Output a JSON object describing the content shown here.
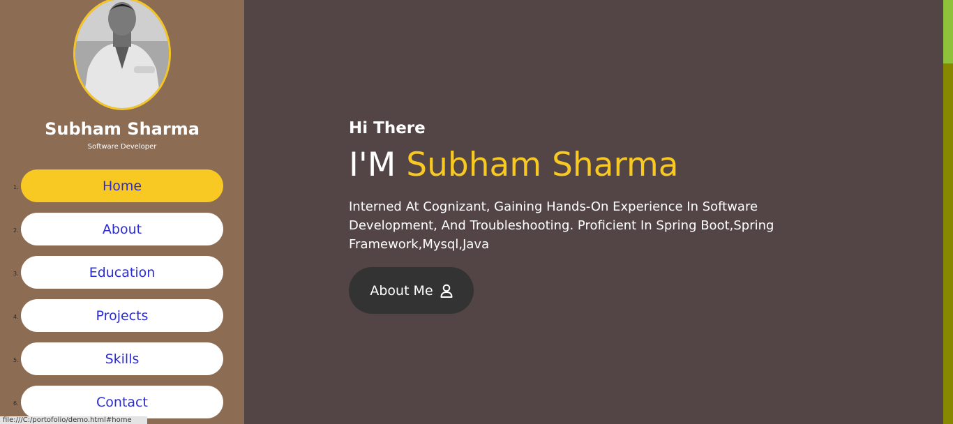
{
  "sidebar": {
    "name": "Subham Sharma",
    "role": "Software Developer",
    "nav": [
      {
        "num": "1.",
        "label": "Home",
        "active": true
      },
      {
        "num": "2.",
        "label": "About"
      },
      {
        "num": "3.",
        "label": "Education"
      },
      {
        "num": "4.",
        "label": "Projects"
      },
      {
        "num": "5.",
        "label": "Skills"
      },
      {
        "num": "6.",
        "label": "Contact"
      }
    ]
  },
  "hero": {
    "greeting": "Hi There",
    "title_prefix": "I'M",
    "title_name": "Subham Sharma",
    "description": "Interned At Cognizant, Gaining Hands-On Experience In Software Development, And Troubleshooting. Proficient In Spring Boot,Spring Framework,Mysql,Java",
    "button_label": "About Me",
    "button_icon": "user-icon"
  },
  "status_bar": {
    "url": "file:///C:/portofolio/demo.html#home"
  },
  "colors": {
    "accent": "#f8c922",
    "sidebar": "#8d6c54",
    "background": "#534545",
    "button": "#333333",
    "nav_text": "#2b2bd6"
  }
}
